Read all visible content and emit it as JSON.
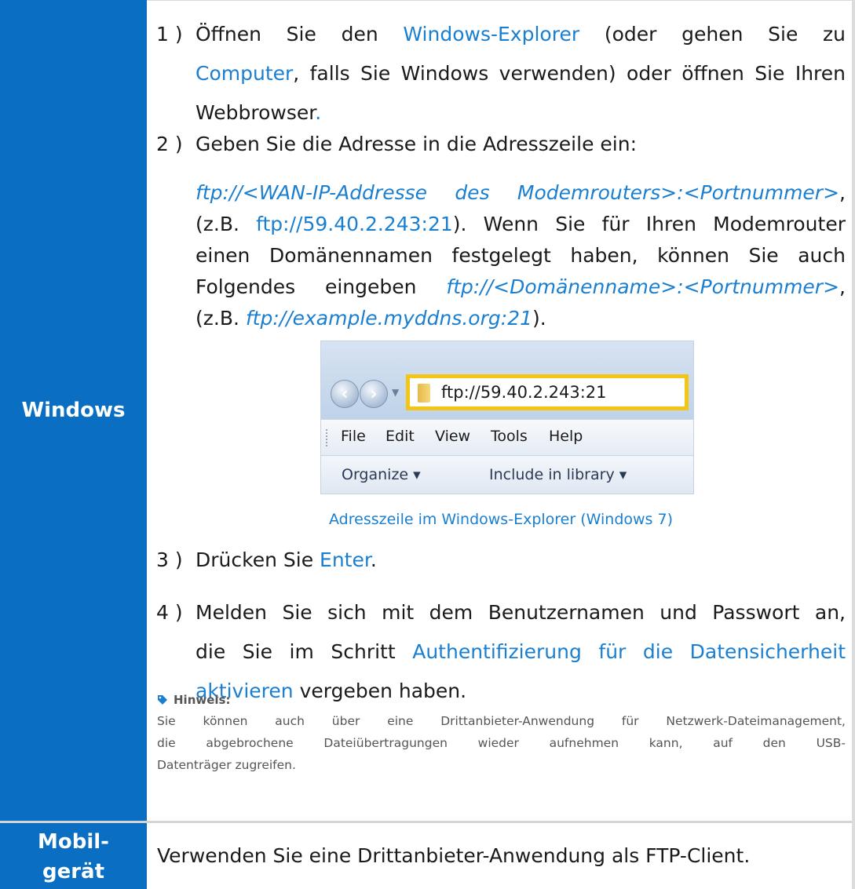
{
  "rows": {
    "windows": {
      "label": "Windows",
      "step1": {
        "num": "1 )",
        "text_a": "Öffnen Sie den ",
        "link_a": "Windows-Explorer",
        "text_b": " (oder gehen Sie zu ",
        "link_b": "Computer",
        "text_c": ", falls Sie Windows verwenden) oder öffnen Sie Ihren",
        "link_c": "Webbrowser",
        "text_d": "."
      },
      "step2": {
        "num": "2 )",
        "text": "Geben Sie die Adresse in die Adresszeile ein:",
        "addr_line1_link": "ftp://<WAN-IP-Addresse des Modemrouters>:<Portnummer>",
        "addr_line1_tail": ",",
        "addr_line2_a": "(z.B. ",
        "addr_line2_link": "ftp://59.40.2.243:21",
        "addr_line2_b": "). Wenn Sie für Ihren Modemrouter",
        "addr_line3": "einen Domänennamen festgelegt haben, können Sie auch",
        "addr_line4_a": "Folgendes eingeben ",
        "addr_line4_link": "ftp://<Domänenname>:<Portnummer>",
        "addr_line4_b": ",",
        "addr_line5_a": "(z.B. ",
        "addr_line5_link": "ftp://example.myddns.org:21",
        "addr_line5_b": ")."
      },
      "screenshot": {
        "address": "ftp://59.40.2.243:21",
        "menu": [
          "File",
          "Edit",
          "View",
          "Tools",
          "Help"
        ],
        "toolbar": [
          "Organize ▾",
          "Include in library ▾"
        ],
        "caption": "Adresszeile im Windows-Explorer (Windows 7)"
      },
      "step3": {
        "num": "3 )",
        "text": "Drücken Sie ",
        "link": "Enter",
        "tail": "."
      },
      "step4": {
        "num": "4 )",
        "line1": "Melden Sie sich mit dem Benutzernamen und Passwort an,",
        "line2_a": "die Sie im Schritt ",
        "line2_link": "Authentifizierung für die Datensicherheit",
        "line3_link": "aktivieren",
        "line3_b": " vergeben haben."
      },
      "note": {
        "heading": "Hinweis:",
        "line1": "Sie können auch über eine Drittanbieter-Anwendung für Netzwerk-Dateimanagement,",
        "line2": "die abgebrochene Dateiübertragungen wieder aufnehmen kann, auf den USB-",
        "line3": "Datenträger zugreifen."
      }
    },
    "mobile": {
      "label_line1": "Mobil-",
      "label_line2": "gerät",
      "text": "Verwenden Sie eine Drittanbieter-Anwendung als FTP-Client."
    }
  },
  "colors": {
    "label_bg": "#0a6fc2",
    "link": "#1a7fd0",
    "highlight": "#f5c515"
  },
  "icons": [
    "tag-icon",
    "back-arrow-icon",
    "forward-arrow-icon",
    "folder-icon"
  ]
}
